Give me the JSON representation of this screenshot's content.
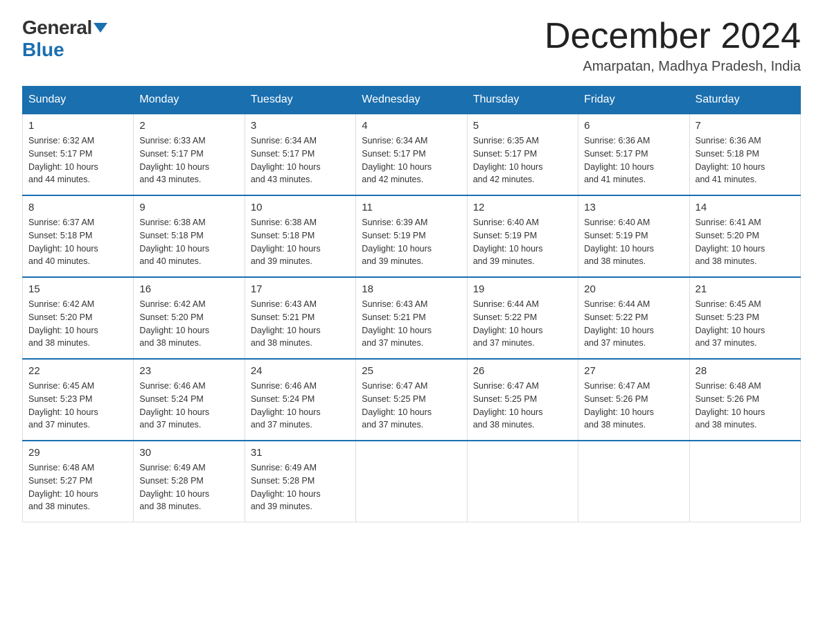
{
  "logo": {
    "general": "General",
    "blue": "Blue"
  },
  "title": "December 2024",
  "subtitle": "Amarpatan, Madhya Pradesh, India",
  "days_of_week": [
    "Sunday",
    "Monday",
    "Tuesday",
    "Wednesday",
    "Thursday",
    "Friday",
    "Saturday"
  ],
  "weeks": [
    [
      {
        "day": "1",
        "sunrise": "6:32 AM",
        "sunset": "5:17 PM",
        "daylight": "10 hours and 44 minutes."
      },
      {
        "day": "2",
        "sunrise": "6:33 AM",
        "sunset": "5:17 PM",
        "daylight": "10 hours and 43 minutes."
      },
      {
        "day": "3",
        "sunrise": "6:34 AM",
        "sunset": "5:17 PM",
        "daylight": "10 hours and 43 minutes."
      },
      {
        "day": "4",
        "sunrise": "6:34 AM",
        "sunset": "5:17 PM",
        "daylight": "10 hours and 42 minutes."
      },
      {
        "day": "5",
        "sunrise": "6:35 AM",
        "sunset": "5:17 PM",
        "daylight": "10 hours and 42 minutes."
      },
      {
        "day": "6",
        "sunrise": "6:36 AM",
        "sunset": "5:17 PM",
        "daylight": "10 hours and 41 minutes."
      },
      {
        "day": "7",
        "sunrise": "6:36 AM",
        "sunset": "5:18 PM",
        "daylight": "10 hours and 41 minutes."
      }
    ],
    [
      {
        "day": "8",
        "sunrise": "6:37 AM",
        "sunset": "5:18 PM",
        "daylight": "10 hours and 40 minutes."
      },
      {
        "day": "9",
        "sunrise": "6:38 AM",
        "sunset": "5:18 PM",
        "daylight": "10 hours and 40 minutes."
      },
      {
        "day": "10",
        "sunrise": "6:38 AM",
        "sunset": "5:18 PM",
        "daylight": "10 hours and 39 minutes."
      },
      {
        "day": "11",
        "sunrise": "6:39 AM",
        "sunset": "5:19 PM",
        "daylight": "10 hours and 39 minutes."
      },
      {
        "day": "12",
        "sunrise": "6:40 AM",
        "sunset": "5:19 PM",
        "daylight": "10 hours and 39 minutes."
      },
      {
        "day": "13",
        "sunrise": "6:40 AM",
        "sunset": "5:19 PM",
        "daylight": "10 hours and 38 minutes."
      },
      {
        "day": "14",
        "sunrise": "6:41 AM",
        "sunset": "5:20 PM",
        "daylight": "10 hours and 38 minutes."
      }
    ],
    [
      {
        "day": "15",
        "sunrise": "6:42 AM",
        "sunset": "5:20 PM",
        "daylight": "10 hours and 38 minutes."
      },
      {
        "day": "16",
        "sunrise": "6:42 AM",
        "sunset": "5:20 PM",
        "daylight": "10 hours and 38 minutes."
      },
      {
        "day": "17",
        "sunrise": "6:43 AM",
        "sunset": "5:21 PM",
        "daylight": "10 hours and 38 minutes."
      },
      {
        "day": "18",
        "sunrise": "6:43 AM",
        "sunset": "5:21 PM",
        "daylight": "10 hours and 37 minutes."
      },
      {
        "day": "19",
        "sunrise": "6:44 AM",
        "sunset": "5:22 PM",
        "daylight": "10 hours and 37 minutes."
      },
      {
        "day": "20",
        "sunrise": "6:44 AM",
        "sunset": "5:22 PM",
        "daylight": "10 hours and 37 minutes."
      },
      {
        "day": "21",
        "sunrise": "6:45 AM",
        "sunset": "5:23 PM",
        "daylight": "10 hours and 37 minutes."
      }
    ],
    [
      {
        "day": "22",
        "sunrise": "6:45 AM",
        "sunset": "5:23 PM",
        "daylight": "10 hours and 37 minutes."
      },
      {
        "day": "23",
        "sunrise": "6:46 AM",
        "sunset": "5:24 PM",
        "daylight": "10 hours and 37 minutes."
      },
      {
        "day": "24",
        "sunrise": "6:46 AM",
        "sunset": "5:24 PM",
        "daylight": "10 hours and 37 minutes."
      },
      {
        "day": "25",
        "sunrise": "6:47 AM",
        "sunset": "5:25 PM",
        "daylight": "10 hours and 37 minutes."
      },
      {
        "day": "26",
        "sunrise": "6:47 AM",
        "sunset": "5:25 PM",
        "daylight": "10 hours and 38 minutes."
      },
      {
        "day": "27",
        "sunrise": "6:47 AM",
        "sunset": "5:26 PM",
        "daylight": "10 hours and 38 minutes."
      },
      {
        "day": "28",
        "sunrise": "6:48 AM",
        "sunset": "5:26 PM",
        "daylight": "10 hours and 38 minutes."
      }
    ],
    [
      {
        "day": "29",
        "sunrise": "6:48 AM",
        "sunset": "5:27 PM",
        "daylight": "10 hours and 38 minutes."
      },
      {
        "day": "30",
        "sunrise": "6:49 AM",
        "sunset": "5:28 PM",
        "daylight": "10 hours and 38 minutes."
      },
      {
        "day": "31",
        "sunrise": "6:49 AM",
        "sunset": "5:28 PM",
        "daylight": "10 hours and 39 minutes."
      },
      null,
      null,
      null,
      null
    ]
  ]
}
